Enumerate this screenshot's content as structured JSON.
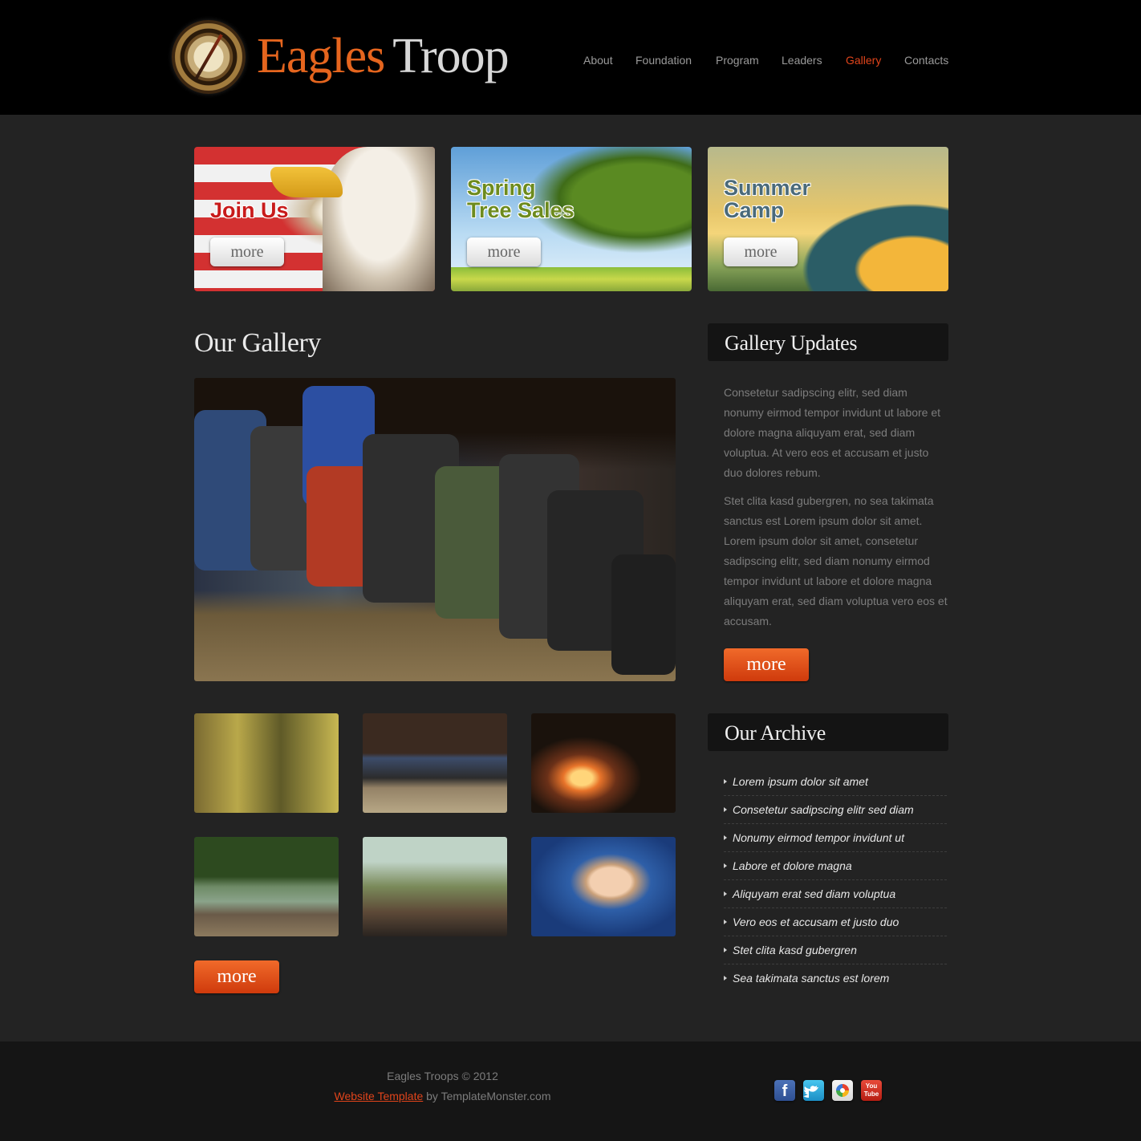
{
  "brand": {
    "name_part1": "Eagles",
    "name_part2": "Troop"
  },
  "nav": [
    {
      "label": "About",
      "active": false
    },
    {
      "label": "Foundation",
      "active": false
    },
    {
      "label": "Program",
      "active": false
    },
    {
      "label": "Leaders",
      "active": false
    },
    {
      "label": "Gallery",
      "active": true
    },
    {
      "label": "Contacts",
      "active": false
    }
  ],
  "banners": [
    {
      "title": "Join Us",
      "button": "more"
    },
    {
      "title_line1": "Spring",
      "title_line2": "Tree Sales",
      "button": "more"
    },
    {
      "title_line1": "Summer",
      "title_line2": "Camp",
      "button": "more"
    }
  ],
  "main": {
    "title": "Our Gallery",
    "more_button": "more"
  },
  "sidebar": {
    "updates_title": "Gallery Updates",
    "paragraph1": "Consetetur sadipscing elitr, sed diam nonumy eirmod tempor invidunt ut labore et dolore magna aliquyam erat, sed diam voluptua. At vero eos et accusam et justo duo dolores rebum.",
    "paragraph2": "Stet clita kasd gubergren, no sea takimata sanctus est Lorem ipsum dolor sit amet. Lorem ipsum dolor sit amet, consetetur sadipscing elitr, sed diam nonumy eirmod tempor invidunt ut labore et dolore magna aliquyam erat, sed diam voluptua vero eos et accusam.",
    "updates_more": "more",
    "archive_title": "Our Archive",
    "archive": [
      "Lorem ipsum dolor sit amet",
      "Consetetur sadipscing elitr sed diam",
      "Nonumy eirmod tempor invidunt ut",
      "Labore et dolore magna",
      "Aliquyam erat sed diam voluptua",
      "Vero eos et accusam et justo duo",
      "Stet clita kasd gubergren",
      "Sea takimata sanctus est lorem"
    ]
  },
  "footer": {
    "copyright": "Eagles Troops © 2012",
    "template_link": "Website Template",
    "by_text": " by TemplateMonster.com",
    "social": {
      "facebook": "f",
      "youtube_line1": "You",
      "youtube_line2": "Tube"
    }
  },
  "colors": {
    "accent": "#e0441b",
    "button_orange": "#e0531a",
    "background": "#232323",
    "header": "#000000"
  },
  "icons": [
    "compass-logo-icon",
    "facebook-icon",
    "twitter-icon",
    "picasa-icon",
    "youtube-icon",
    "bullet-arrow-icon"
  ]
}
